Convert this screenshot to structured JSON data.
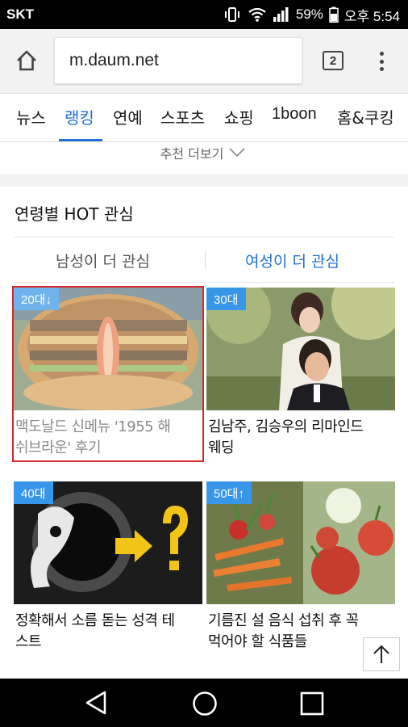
{
  "status_bar": {
    "carrier": "SKT",
    "battery_percent": "59%",
    "time": "오후 5:54",
    "icons": [
      "vibrate-icon",
      "wifi-icon",
      "signal-icon",
      "battery-icon"
    ]
  },
  "browser": {
    "url": "m.daum.net",
    "tab_count": "2",
    "icons": [
      "home-icon",
      "overflow-menu-icon"
    ]
  },
  "nav": {
    "tabs": [
      {
        "label": "뉴스",
        "active": false
      },
      {
        "label": "랭킹",
        "active": true
      },
      {
        "label": "연예",
        "active": false
      },
      {
        "label": "스포츠",
        "active": false
      },
      {
        "label": "쇼핑",
        "active": false
      },
      {
        "label": "1boon",
        "active": false
      },
      {
        "label": "홈&쿠킹",
        "active": false
      }
    ]
  },
  "recommend": {
    "more_label": "추천 더보기"
  },
  "hot": {
    "title": "연령별 HOT 관심",
    "tabs": {
      "male": "남성이 더 관심",
      "female": "여성이 더 관심"
    },
    "active_tab": "female",
    "cards": [
      {
        "badge": "20대↓",
        "caption_lines": [
          "맥도날드 신메뉴 '1955 해",
          "쉬브라운' 후기"
        ],
        "selected": true
      },
      {
        "badge": "30대",
        "caption_lines": [
          "김남주, 김승우의 리마인드",
          "웨딩"
        ],
        "selected": false
      },
      {
        "badge": "40대",
        "caption_lines": [
          "정확해서 소름 돋는 성격 테",
          "스트"
        ],
        "selected": false
      },
      {
        "badge": "50대↑",
        "caption_lines": [
          "기름진 설 음식 섭취 후 꼭",
          "먹어야 할 식품들"
        ],
        "selected": false
      }
    ]
  },
  "colors": {
    "accent": "#1f6fd9",
    "badge": "#3796e8",
    "selection": "#d52a2a"
  }
}
